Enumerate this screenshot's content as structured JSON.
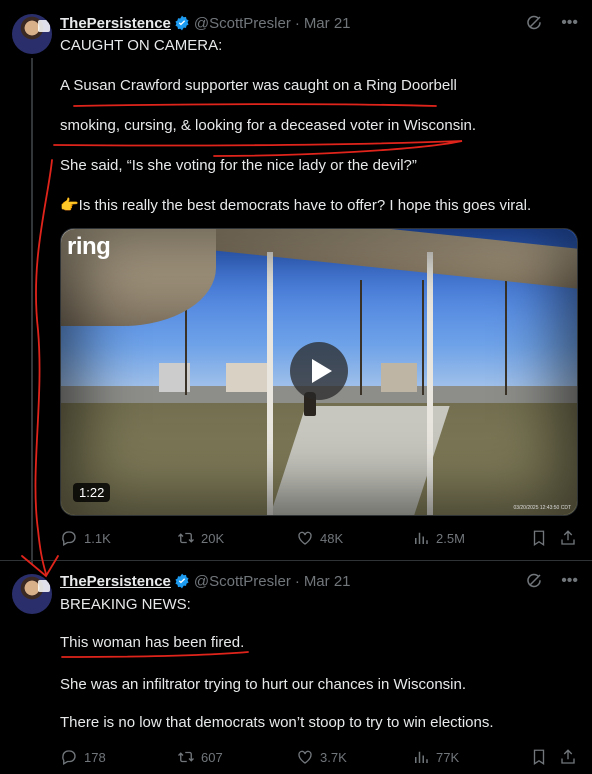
{
  "tweets": [
    {
      "author_name": "ThePersistence",
      "handle": "@ScottPresler",
      "separator": "·",
      "date": "Mar 21",
      "paragraphs": [
        "CAUGHT ON CAMERA:",
        "A Susan Crawford supporter was caught on a Ring Doorbell",
        "smoking, cursing, & looking for a deceased voter in Wisconsin.",
        "She said, “Is she voting for the nice lady or the devil?”",
        "👉Is this really the best democrats have to offer? I hope this goes viral."
      ],
      "media": {
        "brand": "ring",
        "duration": "1:22",
        "timestamp": "03/20/2025 12:43:50 CDT"
      },
      "stats": {
        "replies": "1.1K",
        "reposts": "20K",
        "likes": "48K",
        "views": "2.5M"
      }
    },
    {
      "author_name": "ThePersistence",
      "handle": "@ScottPresler",
      "separator": "·",
      "date": "Mar 21",
      "paragraphs": [
        "BREAKING NEWS:",
        "This woman has been fired.",
        "She was an infiltrator trying to hurt our chances in Wisconsin.",
        "There is no low that democrats won’t stoop to try to win elections."
      ],
      "stats": {
        "replies": "178",
        "reposts": "607",
        "likes": "3.7K",
        "views": "77K"
      }
    }
  ],
  "colors": {
    "background": "#000000",
    "text": "#e7e9ea",
    "muted": "#71767b",
    "verified": "#1d9bf0",
    "annotation": "#e0241b"
  },
  "icons": [
    "verified-badge-icon",
    "grok-icon",
    "more-icon",
    "reply-icon",
    "repost-icon",
    "like-icon",
    "views-icon",
    "bookmark-icon",
    "share-icon",
    "play-icon"
  ]
}
